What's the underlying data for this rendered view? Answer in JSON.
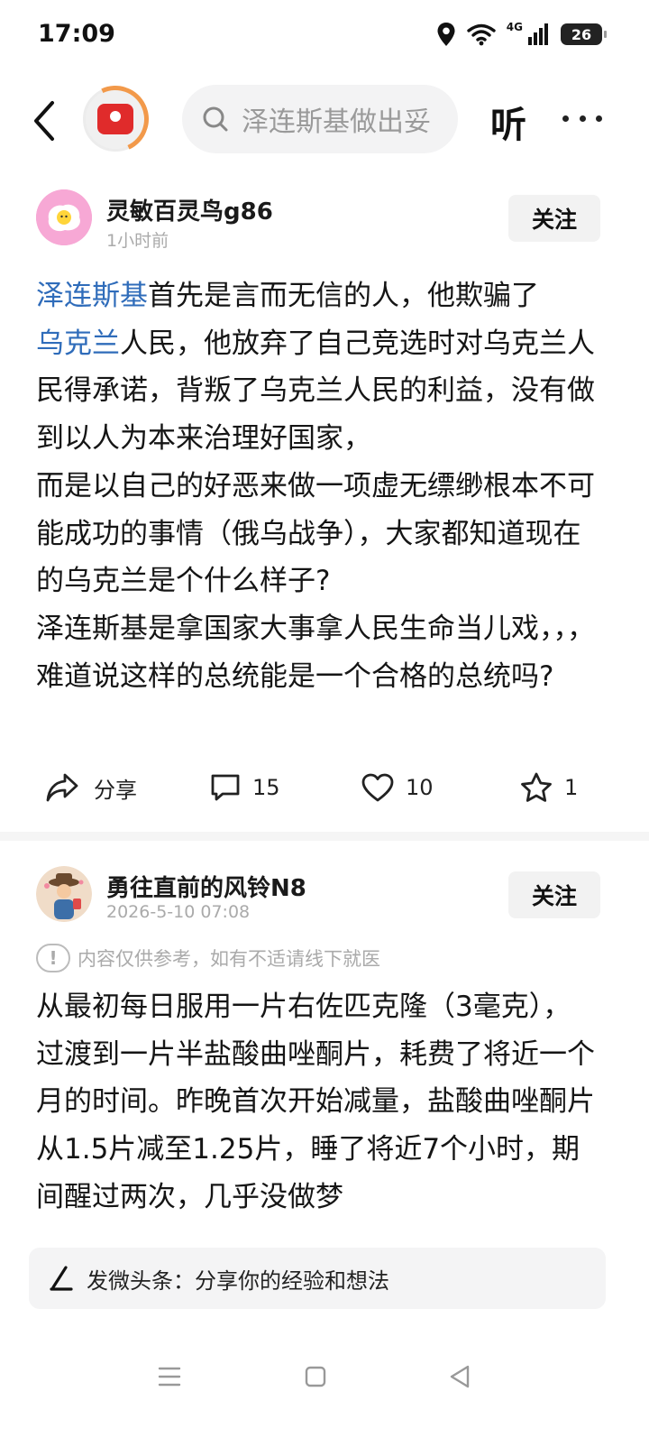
{
  "status": {
    "time": "17:09",
    "network": "4G",
    "battery": "26"
  },
  "topbar": {
    "search_placeholder": "泽连斯基做出妥"
  },
  "listen_label": "听",
  "posts": [
    {
      "author": "灵敏百灵鸟g86",
      "time": "1小时前",
      "follow": "关注",
      "body": {
        "link1": "泽连斯基",
        "text1": "首先是言而无信的人，他欺骗了",
        "link2": "乌克兰",
        "text2": "人民，他放弃了自己竞选时对乌克兰人民得承诺，背叛了乌克兰人民的利益，没有做到以人为本来治理好国家，",
        "text3": "而是以自己的好恶来做一项虚无缥缈根本不可能成功的事情（俄乌战争），大家都知道现在的乌克兰是个什么样子?",
        "text4": "泽连斯基是拿国家大事拿人民生命当儿戏，，，难道说这样的总统能是一个合格的总统吗?"
      },
      "actions": {
        "share": "分享",
        "comments": "15",
        "likes": "10",
        "favorites": "1"
      }
    },
    {
      "author": "勇往直前的风铃N8",
      "time": "2026-5-10 07:08",
      "follow": "关注",
      "disclaimer": "内容仅供参考，如有不适请线下就医",
      "body": "从最初每日服用一片右佐匹克隆（3毫克），过渡到一片半盐酸曲唑酮片，耗费了将近一个月的时间。昨晚首次开始减量，盐酸曲唑酮片从1.5片减至1.25片，睡了将近7个小时，期间醒过两次，几乎没做梦"
    }
  ],
  "composer": {
    "placeholder": "发微头条：分享你的经验和想法"
  },
  "colors": {
    "link": "#2f6cba",
    "follow_bg": "#f2f2f2",
    "logo_red": "#e02b2b",
    "logo_ring": "#f2994a"
  }
}
